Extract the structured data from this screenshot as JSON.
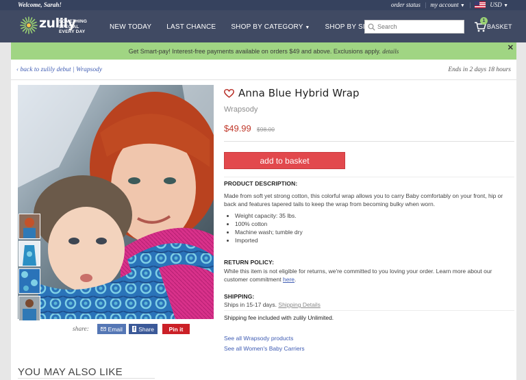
{
  "topbar": {
    "welcome": "Welcome, Sarah!",
    "order_status": "order status",
    "my_account": "my account",
    "currency": "USD"
  },
  "header": {
    "logo": "zulily",
    "tagline_1": "Something",
    "tagline_2": "Special",
    "tagline_3": "Every Day",
    "nav": [
      {
        "label": "NEW TODAY"
      },
      {
        "label": "LAST CHANCE"
      },
      {
        "label": "SHOP BY CATEGORY"
      },
      {
        "label": "SHOP BY SIZE"
      }
    ],
    "search_placeholder": "Search",
    "basket_label": "BASKET",
    "basket_count": "1"
  },
  "promo": {
    "text": "Get Smart-pay! Interest-free payments available on orders $49 and above. Exclusions apply.",
    "link": "details",
    "close": "✕"
  },
  "breadcrumb": {
    "back": "back to zulily debut | Wrapsody",
    "ends": "Ends in 2 days 18 hours"
  },
  "product": {
    "title": "Anna Blue Hybrid Wrap",
    "brand": "Wrapsody",
    "price": "$49.99",
    "old_price": "$98.00",
    "add_button": "add to basket",
    "description_heading": "PRODUCT DESCRIPTION:",
    "description": "Made from soft yet strong cotton, this colorful wrap allows you to carry Baby comfortably on your front, hip or back and features tapered tails to keep the wrap from becoming bulky when worn.",
    "bullets": [
      "Weight capacity: 35 lbs.",
      "100% cotton",
      "Machine wash; tumble dry",
      "Imported"
    ],
    "return_heading": "RETURN POLICY:",
    "return_text": "While this item is not eligible for returns, we're committed to you loving your order. Learn more about our customer commitment",
    "return_link": "here",
    "shipping_heading": "SHIPPING:",
    "shipping_text": "Ships in 15-17 days.",
    "shipping_link": "Shipping Details",
    "unlimited": "Shipping fee included with zulily Unlimited.",
    "see_all_brand": "See all Wrapsody products",
    "see_all_category": "See all Women's Baby Carriers"
  },
  "share": {
    "label": "share:",
    "email": "Email",
    "facebook": "Share",
    "pinterest": "Pin it"
  },
  "recommendations": {
    "heading": "YOU MAY ALSO LIKE"
  },
  "colors": {
    "header_bg": "#404a63",
    "topbar_bg": "#36425e",
    "promo_bg": "#a0d583",
    "price": "#c0392b",
    "add_button": "#e2494d",
    "link": "#3f5cb3"
  }
}
